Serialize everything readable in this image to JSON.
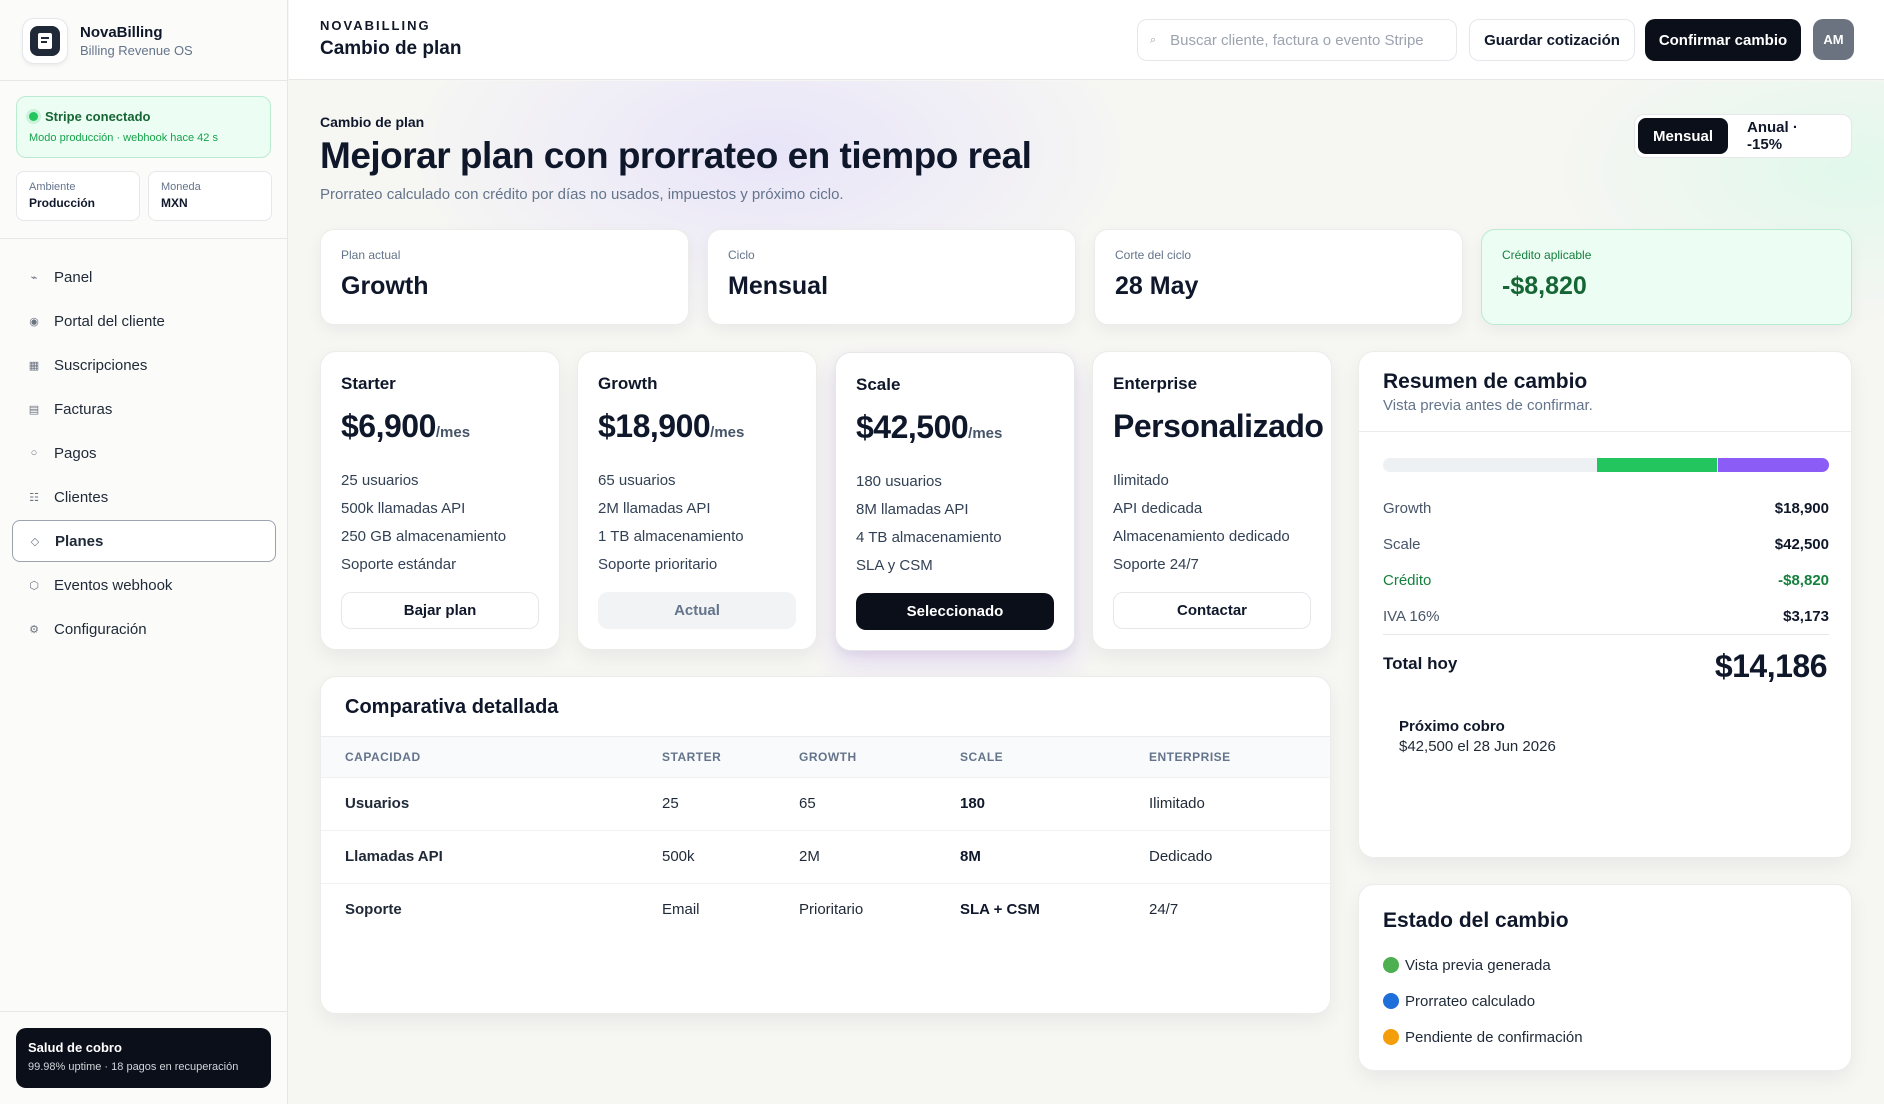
{
  "brand": {
    "name": "NovaBilling",
    "subtitle": "Billing Revenue OS"
  },
  "stripe": {
    "title": "Stripe conectado",
    "subtitle": "Modo producción · webhook hace 42 s"
  },
  "env": {
    "label": "Ambiente",
    "value": "Producción"
  },
  "currency": {
    "label": "Moneda",
    "value": "MXN"
  },
  "nav": [
    {
      "label": "Panel",
      "icon": "pulse-icon",
      "glyph": "⌁"
    },
    {
      "label": "Portal del cliente",
      "icon": "target-icon",
      "glyph": "◉"
    },
    {
      "label": "Suscripciones",
      "icon": "grid-icon",
      "glyph": "▦"
    },
    {
      "label": "Facturas",
      "icon": "invoice-icon",
      "glyph": "▤"
    },
    {
      "label": "Pagos",
      "icon": "circle-icon",
      "glyph": "○"
    },
    {
      "label": "Clientes",
      "icon": "list-icon",
      "glyph": "☷"
    },
    {
      "label": "Planes",
      "icon": "diamond-icon",
      "glyph": "◇",
      "active": true
    },
    {
      "label": "Eventos webhook",
      "icon": "hexagon-icon",
      "glyph": "⬡"
    },
    {
      "label": "Configuración",
      "icon": "gear-icon",
      "glyph": "⚙"
    }
  ],
  "health": {
    "title": "Salud de cobro",
    "subtitle": "99.98% uptime · 18 pagos en recuperación"
  },
  "topbar": {
    "kicker": "NOVABILLING",
    "title": "Cambio de plan",
    "search_placeholder": "Buscar cliente, factura o evento Stripe",
    "save_label": "Guardar cotización",
    "confirm_label": "Confirmar cambio",
    "avatar": "AM"
  },
  "hero": {
    "eyebrow": "Cambio de plan",
    "title": "Mejorar plan con prorrateo en tiempo real",
    "subtitle": "Prorrateo calculado con crédito por días no usados, impuestos y próximo ciclo."
  },
  "billing_toggle": {
    "monthly": "Mensual",
    "annual": "Anual · -15%",
    "selected": "Mensual"
  },
  "stats": [
    {
      "label": "Plan actual",
      "value": "Growth"
    },
    {
      "label": "Ciclo",
      "value": "Mensual"
    },
    {
      "label": "Corte del ciclo",
      "value": "28 May"
    },
    {
      "label": "Crédito aplicable",
      "value": "-$8,820"
    }
  ],
  "plans": [
    {
      "name": "Starter",
      "price": "$6,900",
      "per": "/mes",
      "features": [
        "25 usuarios",
        "500k llamadas API",
        "250 GB almacenamiento",
        "Soporte estándar"
      ],
      "button": "Bajar plan"
    },
    {
      "name": "Growth",
      "price": "$18,900",
      "per": "/mes",
      "features": [
        "65 usuarios",
        "2M llamadas API",
        "1 TB almacenamiento",
        "Soporte prioritario"
      ],
      "button": "Actual"
    },
    {
      "name": "Scale",
      "price": "$42,500",
      "per": "/mes",
      "features": [
        "180 usuarios",
        "8M llamadas API",
        "4 TB almacenamiento",
        "SLA y CSM"
      ],
      "button": "Seleccionado"
    },
    {
      "name": "Enterprise",
      "price": "Personalizado",
      "per": "",
      "features": [
        "Ilimitado",
        "API dedicada",
        "Almacenamiento dedicado",
        "Soporte 24/7"
      ],
      "button": "Contactar"
    }
  ],
  "comparison": {
    "title": "Comparativa detallada",
    "headers": [
      "CAPACIDAD",
      "STARTER",
      "GROWTH",
      "SCALE",
      "ENTERPRISE"
    ],
    "rows": [
      [
        "Usuarios",
        "25",
        "65",
        "180",
        "Ilimitado"
      ],
      [
        "Llamadas API",
        "500k",
        "2M",
        "8M",
        "Dedicado"
      ],
      [
        "Soporte",
        "Email",
        "Prioritario",
        "SLA + CSM",
        "24/7"
      ]
    ]
  },
  "summary": {
    "title": "Resumen de cambio",
    "subtitle": "Vista previa antes de confirmar.",
    "bar": {
      "empty_fraction": 0.48,
      "green_fraction": 0.27,
      "purple_fraction": 0.25,
      "green": "#22c55e",
      "purple": "#8b5cf6"
    },
    "lines": [
      {
        "label": "Growth",
        "value": "$18,900"
      },
      {
        "label": "Scale",
        "value": "$42,500"
      },
      {
        "label": "Crédito",
        "value": "-$8,820"
      },
      {
        "label": "IVA 16%",
        "value": "$3,173"
      }
    ],
    "total_label": "Total hoy",
    "total_value": "$14,186",
    "next_label": "Próximo cobro",
    "next_value": "$42,500 el 28 Jun 2026"
  },
  "status": {
    "title": "Estado del cambio",
    "items": [
      {
        "label": "Vista previa generada",
        "color": "#4caf50"
      },
      {
        "label": "Prorrateo calculado",
        "color": "#1e6fd9"
      },
      {
        "label": "Pendiente de confirmación",
        "color": "#f59e0b"
      }
    ]
  }
}
